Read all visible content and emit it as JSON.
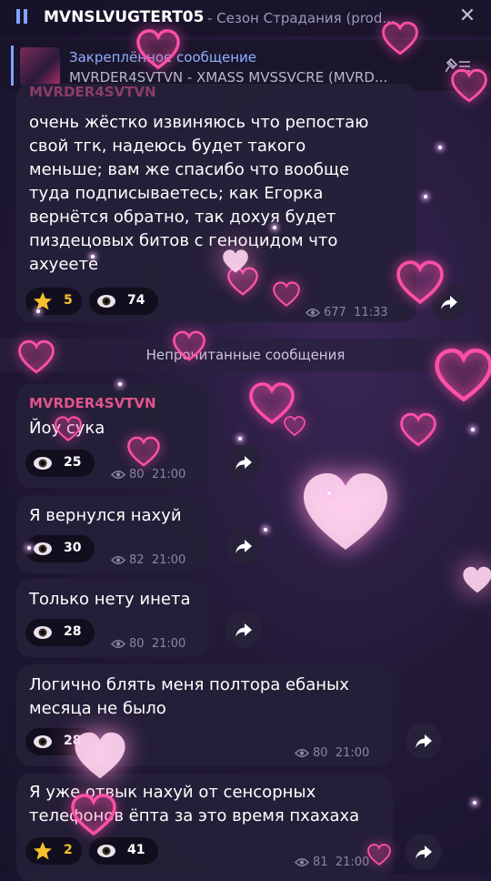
{
  "header": {
    "channel_name": "MVNSLVUGTERT05",
    "subtitle": " - Сезон Страдания (prod...",
    "close_glyph": "✕"
  },
  "pinned": {
    "label": "Закреплённое сообщение",
    "text": "MVRDER4SVTVN - XMASS MVSSVCRE (MVRD..."
  },
  "messages": [
    {
      "sender": "MVRDER4SVTVN",
      "lines": [
        "очень жёстко извиняюсь что репостаю",
        "свой тгк, надеюсь будет такого",
        "меньше; вам же спасибо что вообще",
        "туда подписываетесь; как Егорка",
        "вернётся обратно, так дохуя будет",
        "пиздецовых битов с геноцидом что",
        "ахуеете"
      ],
      "reaction_star": "5",
      "reaction_eye": "74",
      "views": "677",
      "time": "11:33"
    },
    {
      "sender": "MVRDER4SVTVN",
      "lines": [
        "Йоу сука"
      ],
      "reaction_eye": "25",
      "views": "80",
      "time": "21:00"
    },
    {
      "lines": [
        "Я вернулся нахуй"
      ],
      "reaction_eye": "30",
      "views": "82",
      "time": "21:00"
    },
    {
      "lines": [
        "Только нету инета"
      ],
      "reaction_eye": "28",
      "views": "80",
      "time": "21:00"
    },
    {
      "lines": [
        "Логично блять меня полтора ебаных",
        "месяца не было"
      ],
      "reaction_eye": "28",
      "views": "80",
      "time": "21:00"
    },
    {
      "lines": [
        "Я уже отвык нахуй от сенсорных",
        "телефонов ёпта за это время пхахаха"
      ],
      "reaction_star": "2",
      "reaction_eye": "41",
      "views": "81",
      "time": "21:00"
    }
  ],
  "unread_label": "Непрочитанные сообщения",
  "colors": {
    "accent": "#7fa3ff",
    "sender": "#e2548e",
    "bubble": "#252038",
    "heart_pink": "#ff4fa8",
    "heart_glow": "#ffd6f0"
  },
  "icons": {
    "pause": "pause-icon",
    "close": "close-icon",
    "pinned_list": "pinned-list-icon",
    "star": "star-emoji-icon",
    "eye": "eye-emoji-icon",
    "views": "views-eye-icon",
    "share": "share-arrow-icon"
  }
}
